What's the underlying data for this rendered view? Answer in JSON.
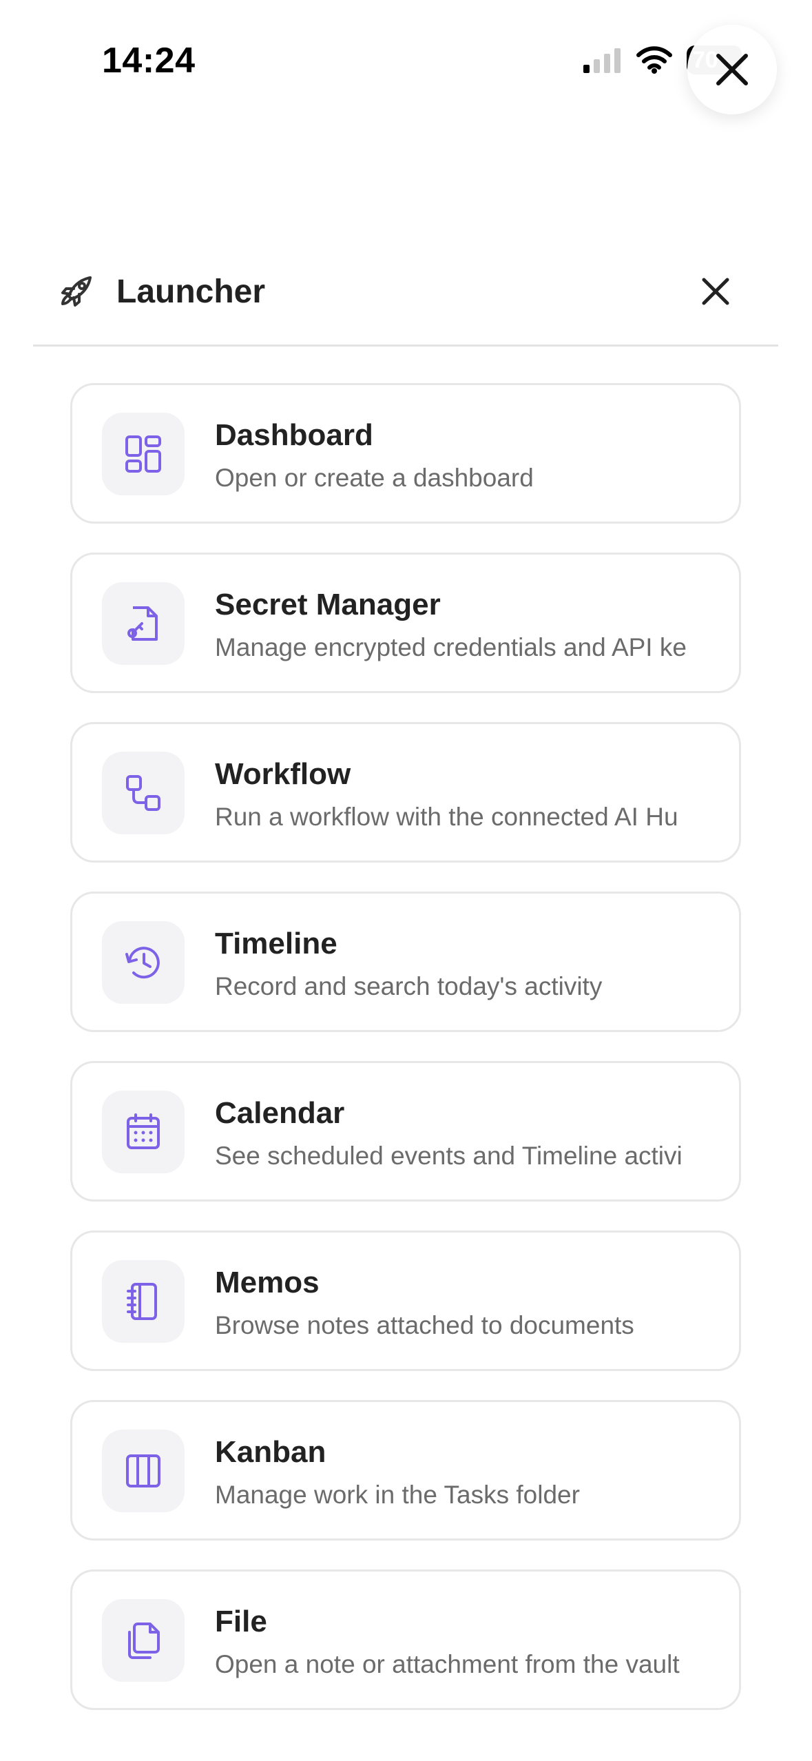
{
  "status_bar": {
    "time": "14:24",
    "battery_level": "70",
    "signal_icon": "signal-icon",
    "wifi_icon": "wifi-icon"
  },
  "launcher": {
    "title": "Launcher",
    "title_icon": "rocket-icon",
    "close_icon": "close-icon"
  },
  "floating_close": {
    "icon": "close-icon"
  },
  "items": [
    {
      "title": "Dashboard",
      "description": "Open or create a dashboard",
      "icon": "dashboard-grid-icon"
    },
    {
      "title": "Secret Manager",
      "description": "Manage encrypted credentials and API ke",
      "icon": "secret-file-icon"
    },
    {
      "title": "Workflow",
      "description": "Run a workflow with the connected AI Hu",
      "icon": "workflow-icon"
    },
    {
      "title": "Timeline",
      "description": "Record and search today's activity",
      "icon": "history-icon"
    },
    {
      "title": "Calendar",
      "description": "See scheduled events and Timeline activi",
      "icon": "calendar-icon"
    },
    {
      "title": "Memos",
      "description": "Browse notes attached to documents",
      "icon": "notebook-icon"
    },
    {
      "title": "Kanban",
      "description": "Manage work in the Tasks folder",
      "icon": "kanban-columns-icon"
    },
    {
      "title": "File",
      "description": "Open a note or attachment from the vault",
      "icon": "files-icon"
    }
  ],
  "colors": {
    "accent": "#7d62e8",
    "card_border": "#e7e7e7",
    "icon_background": "#f3f3f5",
    "title_text": "#222222",
    "description_text": "#6b6b6b"
  }
}
